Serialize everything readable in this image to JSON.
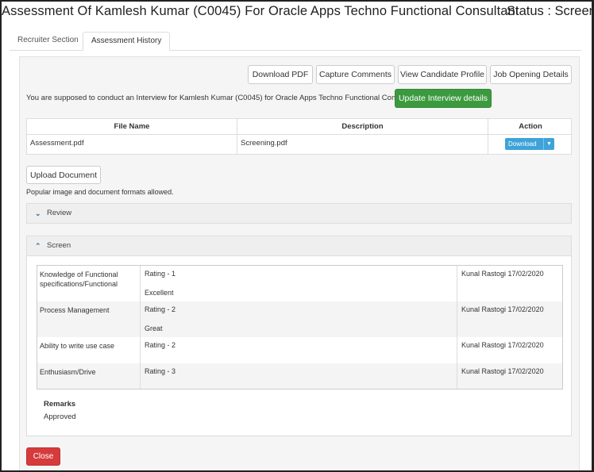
{
  "header": {
    "title": "Assessment Of Kamlesh Kumar (C0045) For Oracle Apps Techno Functional Consultant",
    "status": "Status : Screened"
  },
  "tabs": [
    {
      "label": "Recruiter Section"
    },
    {
      "label": "Assessment History"
    }
  ],
  "toolbar": {
    "download_pdf": "Download PDF",
    "capture_comments": "Capture Comments",
    "view_profile": "View Candidate Profile",
    "job_details": "Job Opening Details"
  },
  "info": {
    "text": "You are supposed to conduct an Interview for Kamlesh Kumar (C0045) for Oracle Apps Techno Functional Consultant.",
    "update_button": "Update Interview details"
  },
  "files": {
    "headers": [
      "File Name",
      "Description",
      "Action"
    ],
    "rows": [
      {
        "name": "Assessment.pdf",
        "description": "Screening.pdf",
        "action": "Download"
      }
    ]
  },
  "upload": {
    "button": "Upload Document",
    "note": "Popular image and document formats allowed."
  },
  "sections": {
    "review": "Review",
    "screen": "Screen"
  },
  "ratings": [
    {
      "criterion": "Knowledge of Functional specifications/Functional",
      "rating": "Rating - 1",
      "comment": "Excellent",
      "reviewer": "Kunal Rastogi 17/02/2020"
    },
    {
      "criterion": "Process Management",
      "rating": "Rating - 2",
      "comment": "Great",
      "reviewer": "Kunal Rastogi 17/02/2020"
    },
    {
      "criterion": "Ability to write use case",
      "rating": "Rating - 2",
      "comment": "",
      "reviewer": "Kunal Rastogi 17/02/2020"
    },
    {
      "criterion": "Enthusiasm/Drive",
      "rating": "Rating - 3",
      "comment": "",
      "reviewer": "Kunal Rastogi 17/02/2020"
    }
  ],
  "remarks": {
    "label": "Remarks",
    "value": "Approved"
  },
  "close_button": "Close",
  "colors": {
    "green": "#3c9a3e",
    "blue": "#3ea3d8",
    "red": "#d63b3b"
  }
}
